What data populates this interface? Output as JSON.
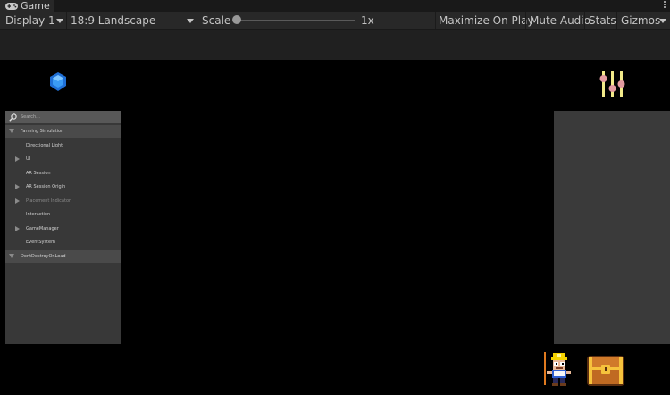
{
  "tab": {
    "title": "Game",
    "icon": "gamepad-icon"
  },
  "toolbar": {
    "display": "Display 1",
    "aspect": "18:9 Landscape",
    "scale_label": "Scale",
    "scale_value": "1x",
    "scale_fraction": 0.0,
    "maximize": "Maximize On Play",
    "mute": "Mute Audio",
    "stats": "Stats",
    "gizmos": "Gizmos"
  },
  "hierarchy": {
    "search_placeholder": "Search...",
    "rows": [
      {
        "label": "Farming Simulation",
        "type": "scene"
      },
      {
        "label": "Directional Light",
        "type": "item"
      },
      {
        "label": "UI",
        "type": "item",
        "expandable": true
      },
      {
        "label": "AR Session",
        "type": "item"
      },
      {
        "label": "AR Session Origin",
        "type": "item",
        "expandable": true
      },
      {
        "label": "Placement Indicator",
        "type": "item",
        "expandable": true,
        "dimmed": true
      },
      {
        "label": "Interaction",
        "type": "item"
      },
      {
        "label": "GameManager",
        "type": "item",
        "expandable": true
      },
      {
        "label": "EventSystem",
        "type": "item"
      },
      {
        "label": "DontDestroyOnLoad",
        "type": "scene"
      }
    ]
  },
  "hud": {
    "gem_icon": "blue-gem-icon",
    "settings_icon": "sliders-icon",
    "miner_icon": "miner-character-icon",
    "chest_icon": "treasure-chest-icon"
  },
  "colors": {
    "accent_gem": "#2e86f0",
    "slider_knob": "#e39aa0",
    "slider_bar": "#f2ea8a",
    "chest_wood": "#d07a2a",
    "chest_gold": "#f6c23c"
  }
}
